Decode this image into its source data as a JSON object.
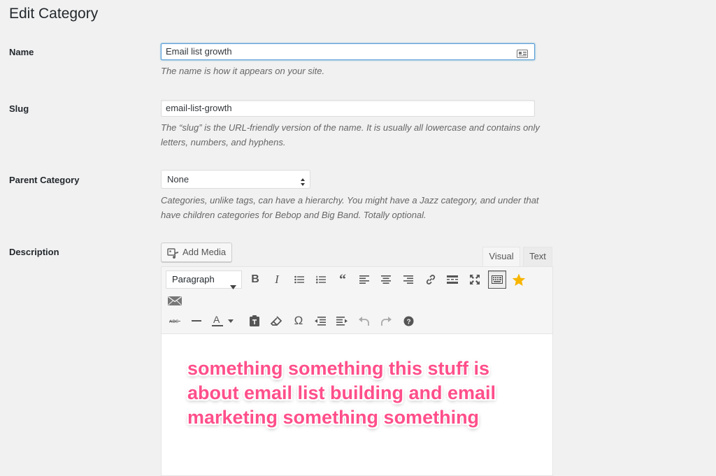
{
  "page": {
    "title": "Edit Category"
  },
  "name_field": {
    "label": "Name",
    "value": "Email list growth",
    "help": "The name is how it appears on your site."
  },
  "slug_field": {
    "label": "Slug",
    "value": "email-list-growth",
    "help": "The “slug” is the URL-friendly version of the name. It is usually all lowercase and contains only letters, numbers, and hyphens."
  },
  "parent_field": {
    "label": "Parent Category",
    "selected": "None",
    "help": "Categories, unlike tags, can have a hierarchy. You might have a Jazz category, and under that have children categories for Bebop and Big Band. Totally optional."
  },
  "description": {
    "label": "Description",
    "add_media_label": "Add Media",
    "tabs": {
      "visual": "Visual",
      "text": "Text"
    },
    "format_select": "Paragraph",
    "content": "something something this stuff is about email list building and email marketing something something"
  },
  "toolbar_icons": [
    "bold-icon",
    "italic-icon",
    "bullet-list-icon",
    "numbered-list-icon",
    "blockquote-icon",
    "align-left-icon",
    "align-center-icon",
    "align-right-icon",
    "link-icon",
    "read-more-icon",
    "fullscreen-icon",
    "toolbar-toggle-icon",
    "star-icon",
    "email-icon",
    "strikethrough-icon",
    "horizontal-line-icon",
    "text-color-icon",
    "paste-as-text-icon",
    "clear-formatting-icon",
    "special-character-icon",
    "outdent-icon",
    "indent-icon",
    "undo-icon",
    "redo-icon",
    "help-icon"
  ],
  "colors": {
    "background": "#f1f1f1",
    "focus_border": "#5b9dd9",
    "content_text": "#ff4f8b",
    "star": "#f7b500"
  }
}
